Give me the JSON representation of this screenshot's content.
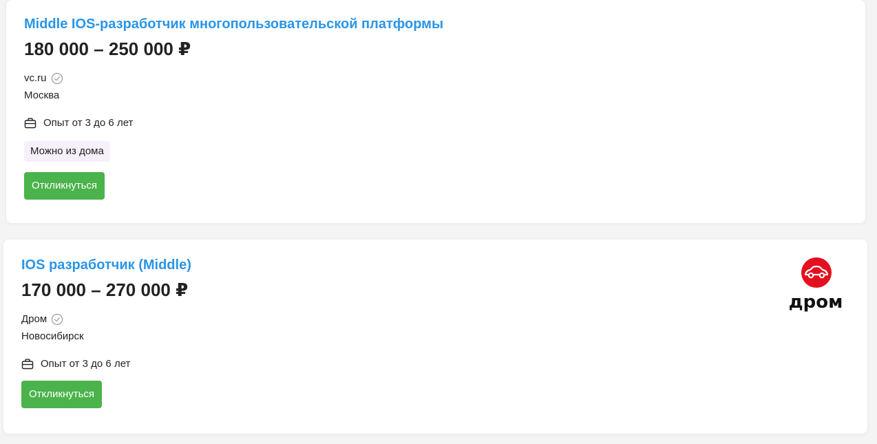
{
  "vacancies": [
    {
      "title": "Middle IOS-разработчик многопользовательской платформы",
      "salary": "180 000 – 250 000 ₽",
      "company": "vc.ru",
      "city": "Москва",
      "experience": "Опыт от 3 до 6 лет",
      "badge": "Можно из дома",
      "respond_label": "Откликнуться"
    },
    {
      "title": "IOS разработчик (Middle)",
      "salary": "170 000 – 270 000 ₽",
      "company": "Дром",
      "city": "Новосибирск",
      "experience": "Опыт от 3 до 6 лет",
      "respond_label": "Откликнуться",
      "logo_text": "дром"
    }
  ],
  "colors": {
    "title": "#2a95e8",
    "button": "#4bb34b",
    "badge_bg": "#f6effc",
    "logo_red": "#e3101f"
  },
  "icons": {
    "verified": "check-circle-icon",
    "experience": "briefcase-icon"
  }
}
